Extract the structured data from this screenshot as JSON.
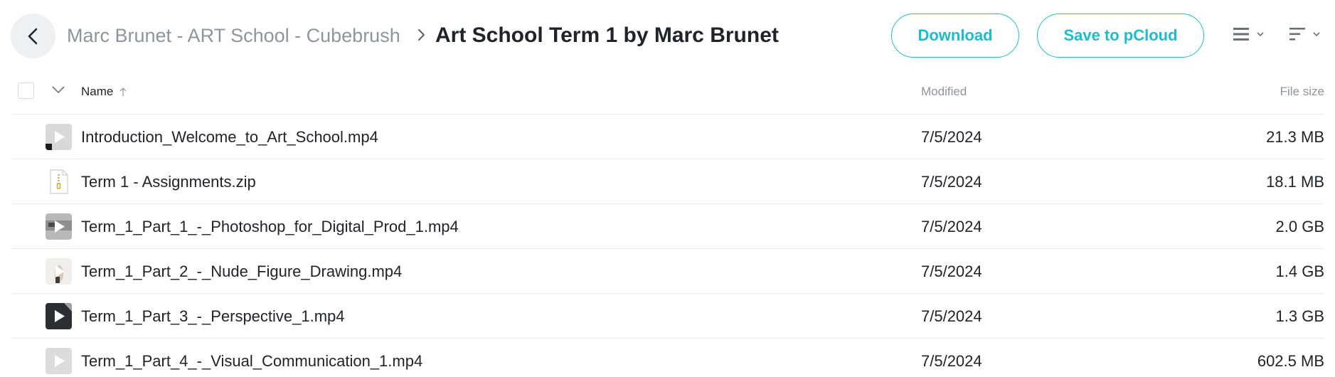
{
  "breadcrumb": {
    "parent": "Marc Brunet - ART School - Cubebrush",
    "current": "Art School Term 1 by Marc Brunet"
  },
  "actions": {
    "download_label": "Download",
    "save_label": "Save to pCloud"
  },
  "columns": {
    "name": "Name",
    "modified": "Modified",
    "size": "File size"
  },
  "colors": {
    "accent": "#17bed0",
    "muted_text": "#8f959c",
    "text": "#20242a",
    "divider": "#e9ecee"
  },
  "files": [
    {
      "name": "Introduction_Welcome_to_Art_School.mp4",
      "modified": "7/5/2024",
      "size": "21.3 MB",
      "icon": "video-thumbnail-icon"
    },
    {
      "name": "Term 1 - Assignments.zip",
      "modified": "7/5/2024",
      "size": "18.1 MB",
      "icon": "zip-file-icon"
    },
    {
      "name": "Term_1_Part_1_-_Photoshop_for_Digital_Prod_1.mp4",
      "modified": "7/5/2024",
      "size": "2.0 GB",
      "icon": "video-thumbnail-icon"
    },
    {
      "name": "Term_1_Part_2_-_Nude_Figure_Drawing.mp4",
      "modified": "7/5/2024",
      "size": "1.4 GB",
      "icon": "video-thumbnail-icon"
    },
    {
      "name": "Term_1_Part_3_-_Perspective_1.mp4",
      "modified": "7/5/2024",
      "size": "1.3 GB",
      "icon": "video-thumbnail-icon"
    },
    {
      "name": "Term_1_Part_4_-_Visual_Communication_1.mp4",
      "modified": "7/5/2024",
      "size": "602.5 MB",
      "icon": "video-thumbnail-icon"
    }
  ]
}
